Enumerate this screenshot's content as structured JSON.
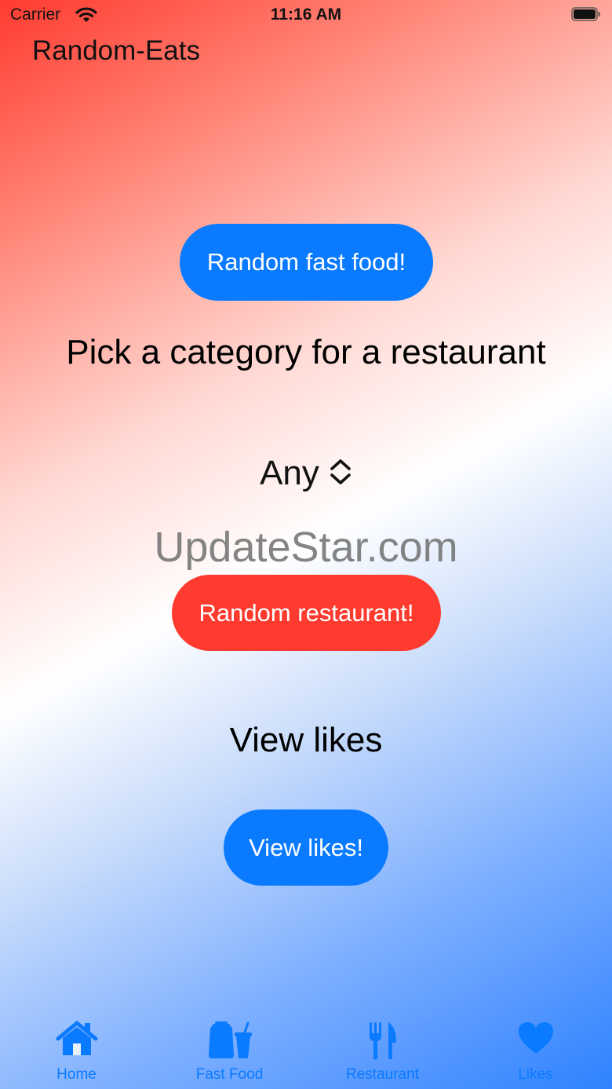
{
  "status_bar": {
    "carrier": "Carrier",
    "time": "11:16 AM"
  },
  "app": {
    "title": "Random-Eats"
  },
  "fast_food_button": {
    "label": "Random fast food!"
  },
  "category_heading": "Pick a category for a restaurant",
  "category_picker": {
    "value": "Any"
  },
  "watermark": "UpdateStar.com",
  "restaurant_button": {
    "label": "Random restaurant!"
  },
  "likes_heading": "View likes",
  "likes_button": {
    "label": "View likes!"
  },
  "tabs": [
    {
      "label": "Home",
      "icon": "house-icon"
    },
    {
      "label": "Fast Food",
      "icon": "takeout-bag-icon"
    },
    {
      "label": "Restaurant",
      "icon": "fork-knife-icon"
    },
    {
      "label": "Likes",
      "icon": "heart-icon"
    }
  ],
  "colors": {
    "accent": "#0a7aff",
    "restaurant_button": "#ff3b30"
  }
}
